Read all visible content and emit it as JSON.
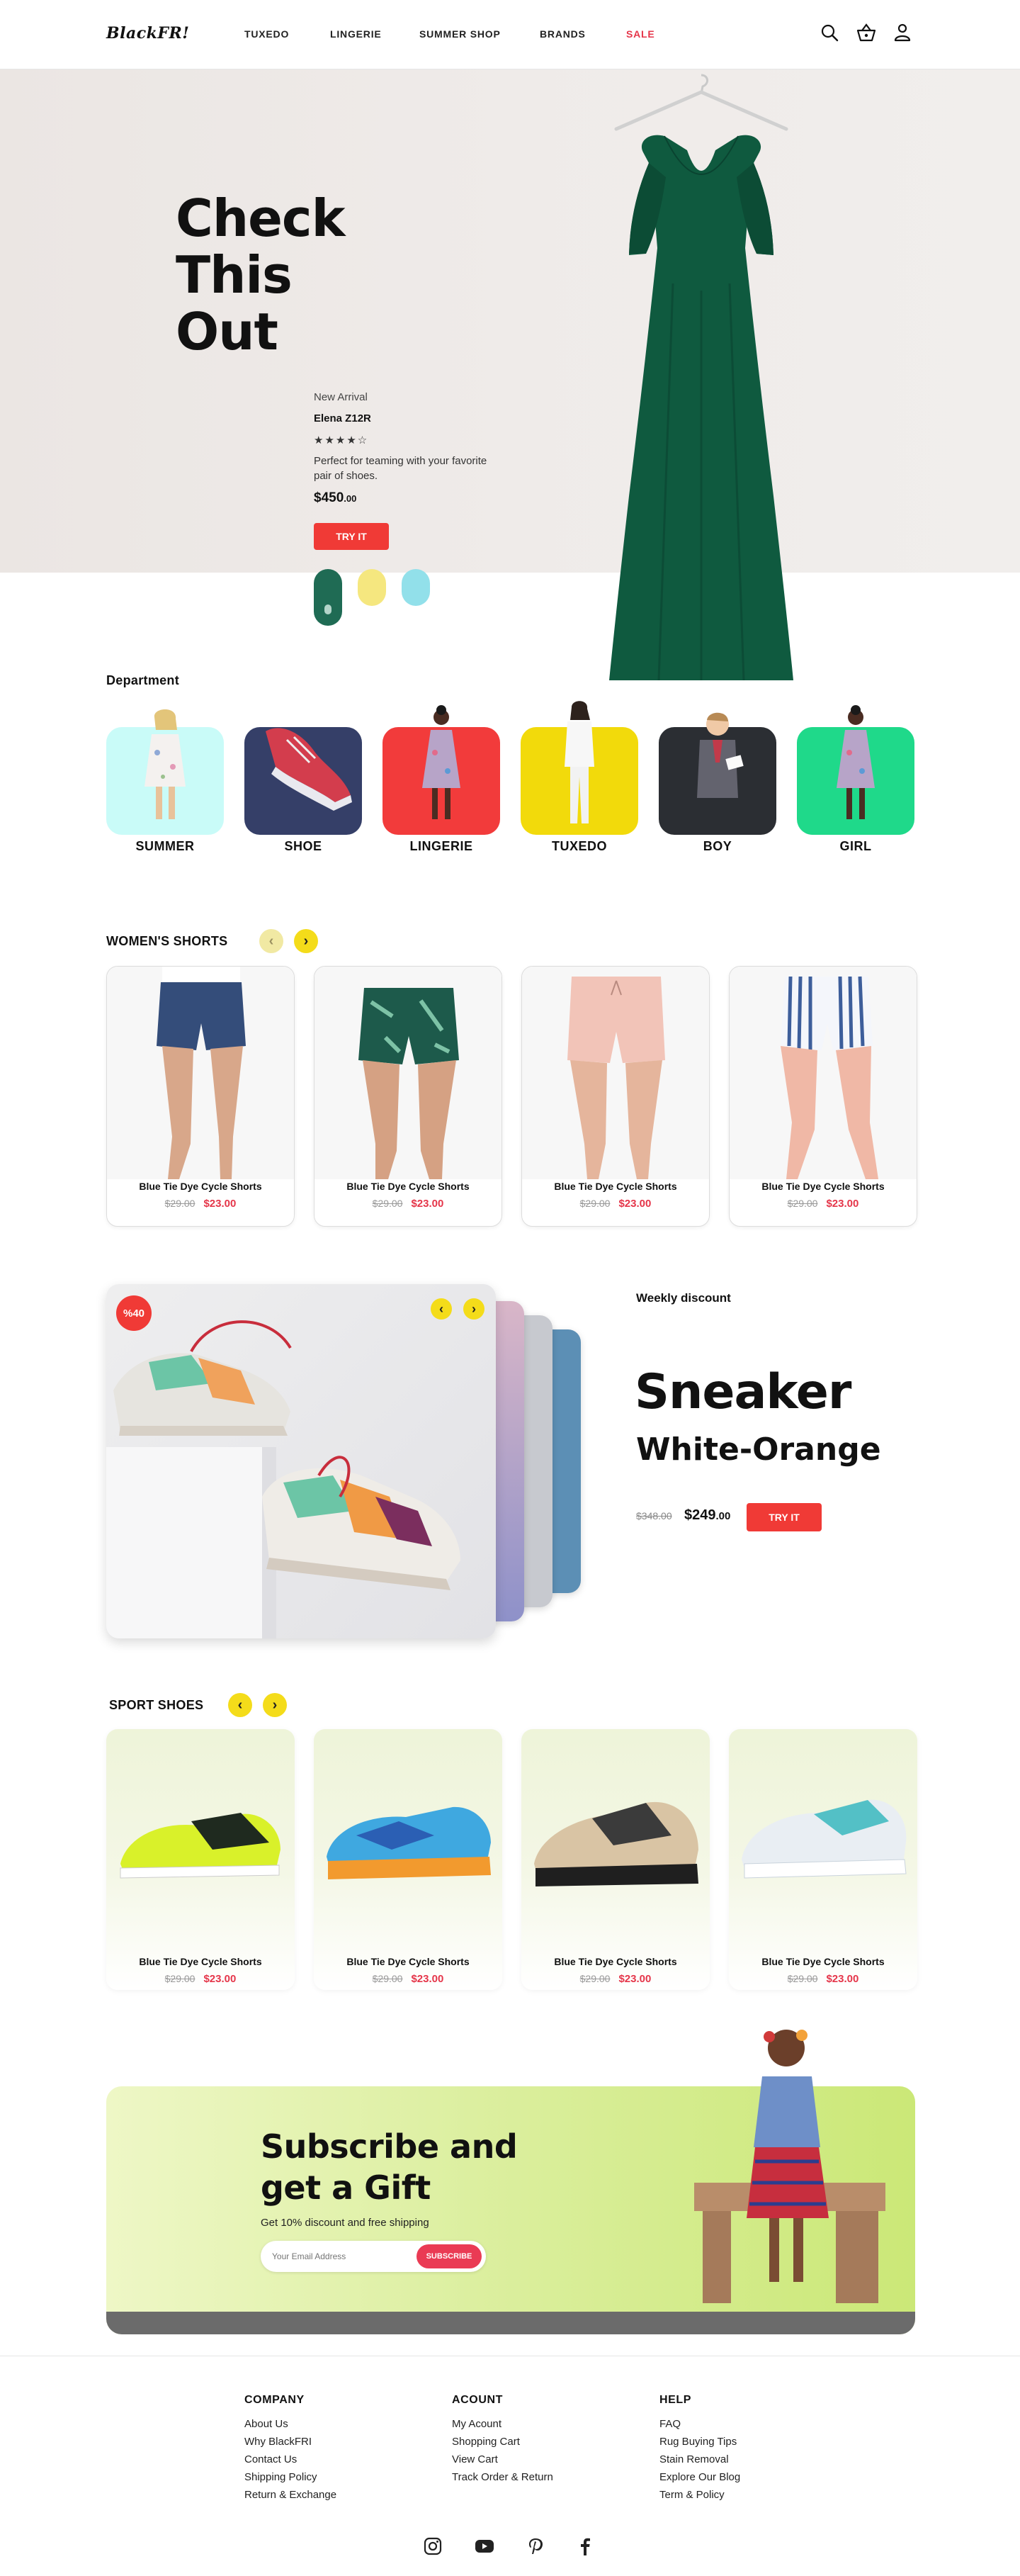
{
  "header": {
    "logo": "BlackFR!",
    "nav": [
      "TUXEDO",
      "LINGERIE",
      "SUMMER SHOP",
      "BRANDS",
      "SALE"
    ],
    "icons": [
      "search-icon",
      "basket-icon",
      "user-icon"
    ]
  },
  "hero": {
    "title_lines": [
      "Check",
      "This",
      "Out"
    ],
    "tag": "New Arrival",
    "product_name": "Elena Z12R",
    "stars": "★★★★☆",
    "description": "Perfect for teaming with your favorite pair of shoes.",
    "price": "$450",
    "price_cents": ".00",
    "button": "TRY IT",
    "pill_colors": [
      "#1f6b54",
      "#f5e77f",
      "#92e0ea"
    ]
  },
  "department": {
    "title": "Department",
    "items": [
      {
        "label": "SUMMER",
        "color": "#c9fbf8"
      },
      {
        "label": "SHOE",
        "color": "#353f68"
      },
      {
        "label": "LINGERIE",
        "color": "#f23b3b"
      },
      {
        "label": "TUXEDO",
        "color": "#f2da0b"
      },
      {
        "label": "BOY",
        "color": "#2b2e33"
      },
      {
        "label": "GIRL",
        "color": "#1fd98a"
      }
    ]
  },
  "womens_shorts": {
    "title": "WOMEN'S SHORTS",
    "products": [
      {
        "name": "Blue Tie Dye Cycle Shorts",
        "old": "$29.00",
        "new": "$23.00"
      },
      {
        "name": "Blue Tie Dye Cycle Shorts",
        "old": "$29.00",
        "new": "$23.00"
      },
      {
        "name": "Blue Tie Dye Cycle Shorts",
        "old": "$29.00",
        "new": "$23.00"
      },
      {
        "name": "Blue Tie Dye Cycle Shorts",
        "old": "$29.00",
        "new": "$23.00"
      }
    ]
  },
  "weekly": {
    "label": "Weekly discount",
    "badge": "%40",
    "title": "Sneaker",
    "subtitle": "White-Orange",
    "old_price": "$348.00",
    "new_price": "$249",
    "new_cents": ".00",
    "button": "TRY IT"
  },
  "sport_shoes": {
    "title": "SPORT SHOES",
    "products": [
      {
        "name": "Blue Tie Dye Cycle Shorts",
        "old": "$29.00",
        "new": "$23.00"
      },
      {
        "name": "Blue Tie Dye Cycle Shorts",
        "old": "$29.00",
        "new": "$23.00"
      },
      {
        "name": "Blue Tie Dye Cycle Shorts",
        "old": "$29.00",
        "new": "$23.00"
      },
      {
        "name": "Blue Tie Dye Cycle Shorts",
        "old": "$29.00",
        "new": "$23.00"
      }
    ]
  },
  "subscribe": {
    "title_lines": [
      "Subscribe and",
      "get a Gift"
    ],
    "text": "Get 10% discount and free shipping",
    "placeholder": "Your Email Address",
    "button": "SUBSCRIBE"
  },
  "footer": {
    "columns": [
      {
        "title": "COMPANY",
        "links": [
          "About Us",
          "Why BlackFRI",
          "Contact Us",
          "Shipping Policy",
          "Return & Exchange"
        ]
      },
      {
        "title": "ACOUNT",
        "links": [
          "My Acount",
          "Shopping Cart",
          "View Cart",
          "Track Order & Return"
        ]
      },
      {
        "title": "HELP",
        "links": [
          "FAQ",
          "Rug Buying Tips",
          "Stain Removal",
          "Explore Our Blog",
          "Term & Policy"
        ]
      }
    ],
    "social": [
      "instagram-icon",
      "youtube-icon",
      "pinterest-icon",
      "facebook-icon"
    ]
  }
}
